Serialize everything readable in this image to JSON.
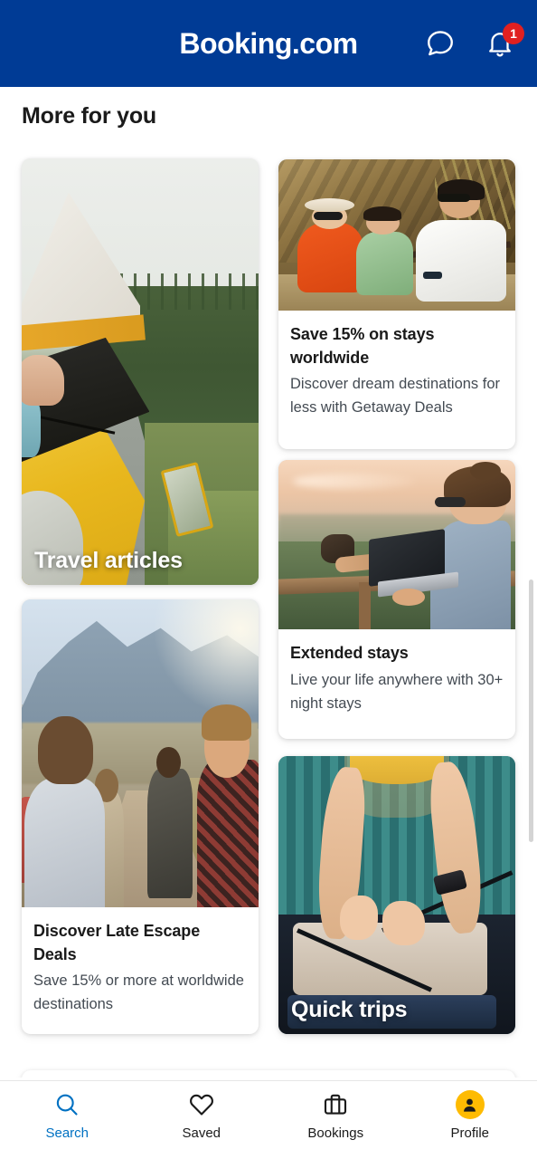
{
  "header": {
    "brand": "Booking.com",
    "chat_icon": "chat-bubble-icon",
    "notifications_icon": "bell-icon",
    "notification_count": "1",
    "background_color": "#003b95",
    "badge_color": "#e02020"
  },
  "page": {
    "title": "More for you"
  },
  "cards": [
    {
      "id": "travel-articles",
      "overlay_title": "Travel articles",
      "title": "",
      "subtitle": "",
      "image_alt": "Person leaning out of a yellow camper van window on a forest road"
    },
    {
      "id": "save-15-stays-worldwide",
      "overlay_title": "",
      "title": "Save 15% on stays worldwide",
      "subtitle": "Discover dream destinations for less with Getaway Deals",
      "image_alt": "Family relaxing in camp chairs beside a rock face"
    },
    {
      "id": "extended-stays",
      "overlay_title": "",
      "title": "Extended stays",
      "subtitle": "Live your life anywhere with 30+ night stays",
      "image_alt": "Woman working on a laptop on a balcony at sunset"
    },
    {
      "id": "discover-late-escape-deals",
      "overlay_title": "",
      "title": "Discover Late Escape Deals",
      "subtitle": "Save 15% or more at worldwide destinations",
      "image_alt": "Group of hikers walking a mountain trail"
    },
    {
      "id": "quick-trips",
      "overlay_title": "Quick trips",
      "title": "",
      "subtitle": "",
      "image_alt": "Hands fastening straps inside an open suitcase"
    }
  ],
  "bottom_nav": {
    "active": "Search",
    "active_color": "#0071c2",
    "avatar_color": "#febb02",
    "items": [
      {
        "label": "Search",
        "icon": "search-icon"
      },
      {
        "label": "Saved",
        "icon": "heart-icon"
      },
      {
        "label": "Bookings",
        "icon": "suitcase-icon"
      },
      {
        "label": "Profile",
        "icon": "avatar-icon"
      }
    ]
  }
}
